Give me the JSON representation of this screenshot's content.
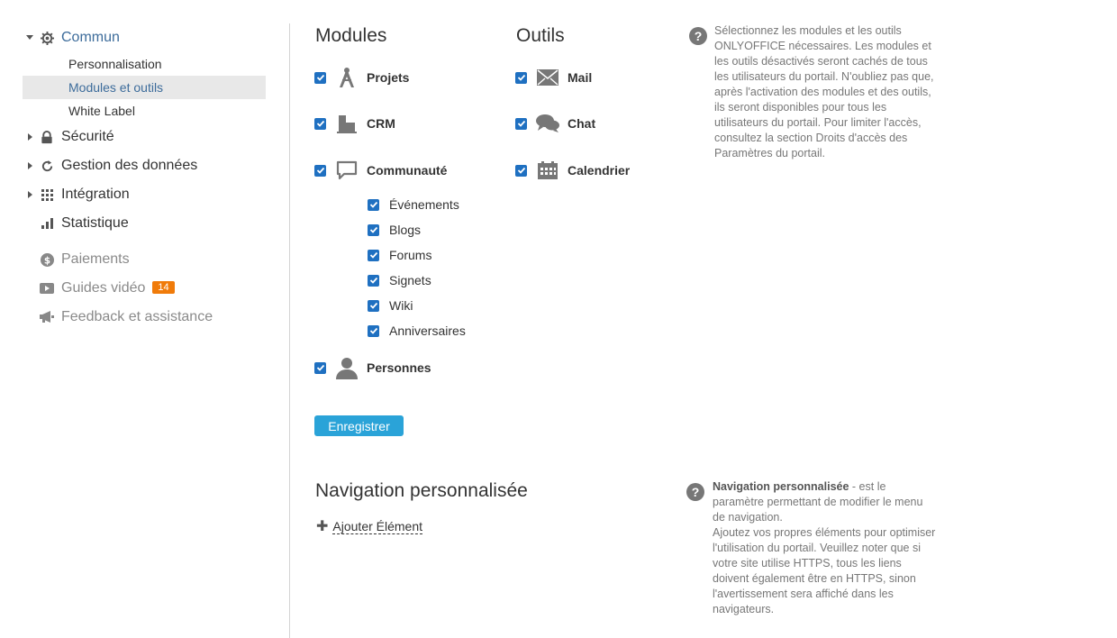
{
  "sidebar": {
    "commun": "Commun",
    "personnalisation": "Personnalisation",
    "modules_outils": "Modules et outils",
    "white_label": "White Label",
    "securite": "Sécurité",
    "gestion": "Gestion des données",
    "integration": "Intégration",
    "statistique": "Statistique",
    "paiements": "Paiements",
    "guides": "Guides vidéo",
    "guides_badge": "14",
    "feedback": "Feedback et assistance"
  },
  "modules": {
    "title": "Modules",
    "items": [
      "Projets",
      "CRM",
      "Communauté",
      "Personnes"
    ],
    "community_sub": [
      "Événements",
      "Blogs",
      "Forums",
      "Signets",
      "Wiki",
      "Anniversaires"
    ]
  },
  "outils": {
    "title": "Outils",
    "items": [
      "Mail",
      "Chat",
      "Calendrier"
    ]
  },
  "save_button": "Enregistrer",
  "help_modules": "Sélectionnez les modules et les outils ONLYOFFICE nécessaires. Les modules et les outils désactivés seront cachés de tous les utilisateurs du portail. N'oubliez pas que, après l'activation des modules et des outils, ils seront disponibles pour tous les utilisateurs du portail. Pour limiter l'accès, consultez la section Droits d'accès des Paramètres du portail.",
  "nav_section": {
    "title": "Navigation personnalisée",
    "add_label": "Ajouter Élément",
    "help_bold": "Navigation personnalisée",
    "help_rest": " - est le paramètre permettant de modifier le menu de navigation.",
    "help_rest2": "Ajoutez vos propres éléments pour optimiser l'utilisation du portail. Veuillez noter que si votre site utilise HTTPS, tous les liens doivent également être en HTTPS, sinon l'avertissement sera affiché dans les navigateurs."
  },
  "colors": {
    "accent": "#3d6c9b",
    "checkbox": "#1f70c1",
    "button": "#2aa3d8",
    "badge": "#f07b0a"
  }
}
